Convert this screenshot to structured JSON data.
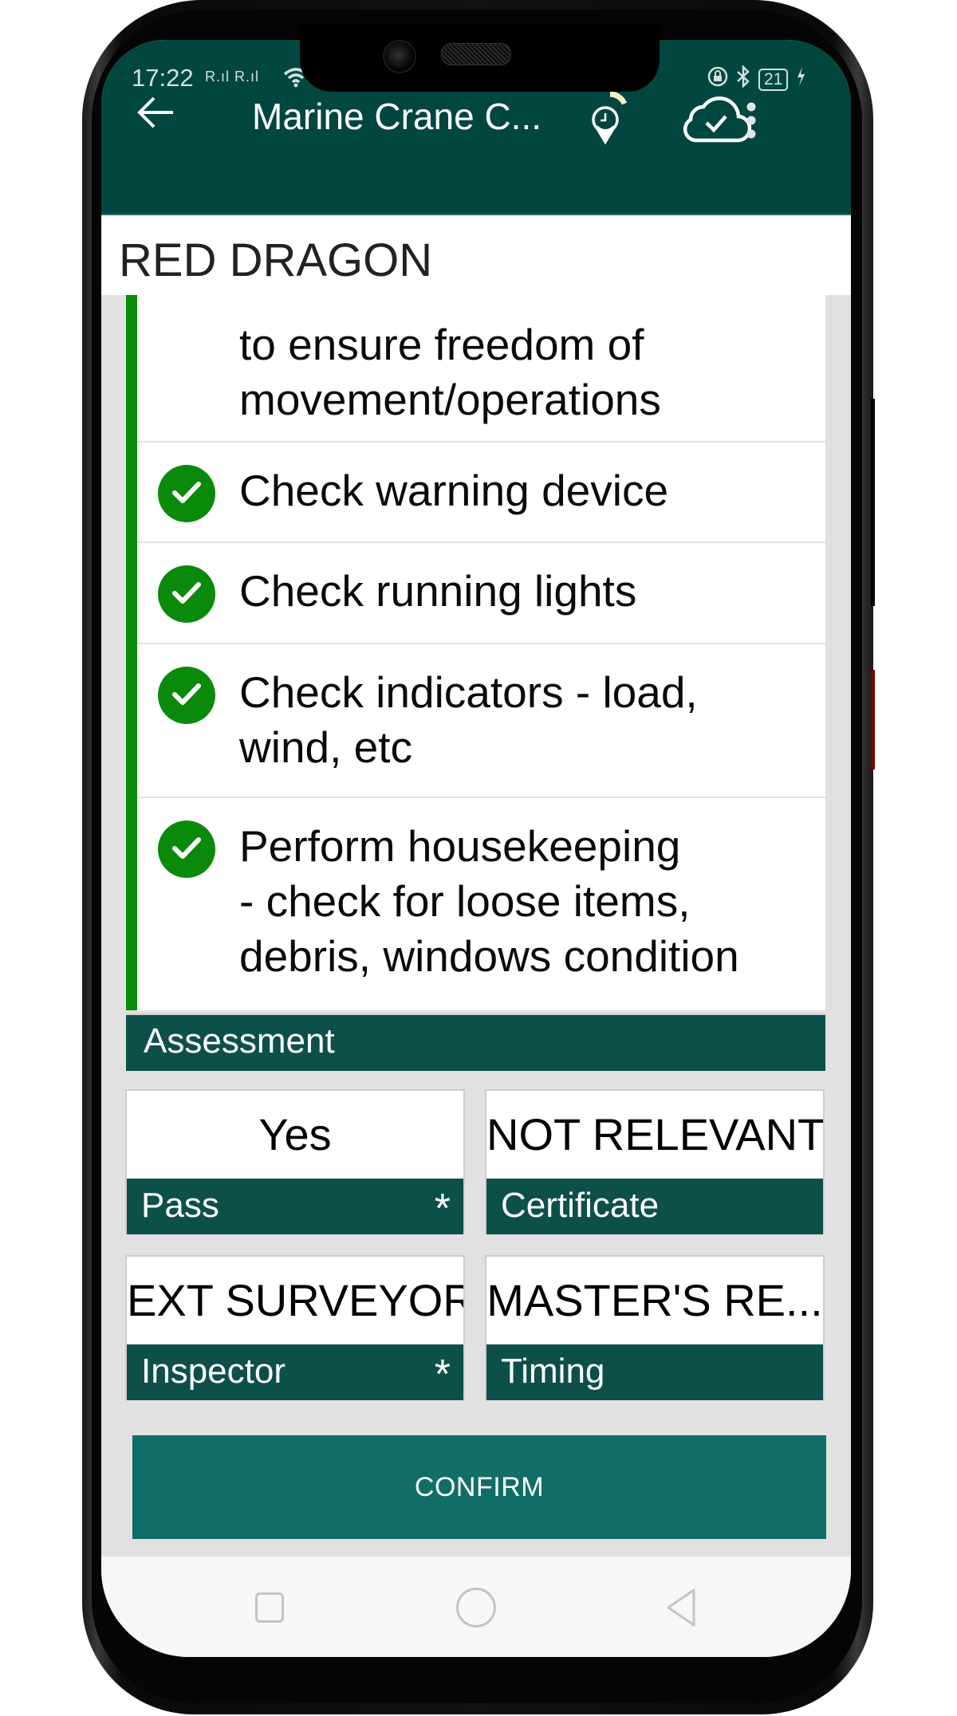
{
  "status_bar": {
    "time": "17:22",
    "signal": "R.ıl R.ıl",
    "battery_level": "21",
    "icons": [
      "wifi-icon",
      "rotation-lock-icon",
      "bluetooth-icon",
      "battery-icon",
      "charging-icon"
    ]
  },
  "app_bar": {
    "title": "Marine Crane C...",
    "back_icon": "arrow-left-icon",
    "actions": [
      "location-time-icon",
      "cloud-synced-icon",
      "more-vert-icon"
    ]
  },
  "vessel": {
    "name": "RED DRAGON"
  },
  "checklist": {
    "accent_color": "#0a8a0a",
    "items": [
      {
        "text_partial": "to ensure freedom of\nmovement/operations",
        "checked": true,
        "visible_icon": false
      },
      {
        "text": "Check warning device",
        "checked": true
      },
      {
        "text": "Check running lights",
        "checked": true
      },
      {
        "text": "Check indicators - load,\nwind, etc",
        "checked": true
      },
      {
        "text": "Perform housekeeping\n- check for loose items,\ndebris, windows condition",
        "checked": true
      }
    ]
  },
  "assessment": {
    "header": "Assessment",
    "fields": [
      {
        "value": "Yes",
        "label": "Pass",
        "required": "*"
      },
      {
        "value": "NOT RELEVANT",
        "label": "Certificate",
        "required": ""
      },
      {
        "value": "EXT SURVEYOR",
        "label": "Inspector",
        "required": "*"
      },
      {
        "value": "MASTER'S RE...",
        "label": "Timing",
        "required": ""
      }
    ]
  },
  "actions": {
    "confirm_label": "CONFIRM"
  },
  "nav_bar": {
    "buttons": [
      "recent-apps",
      "home",
      "back"
    ]
  },
  "colors": {
    "app_bar": "#02473f",
    "label_bar": "#0d5049",
    "confirm": "#106e67",
    "check": "#0a8a0a"
  }
}
